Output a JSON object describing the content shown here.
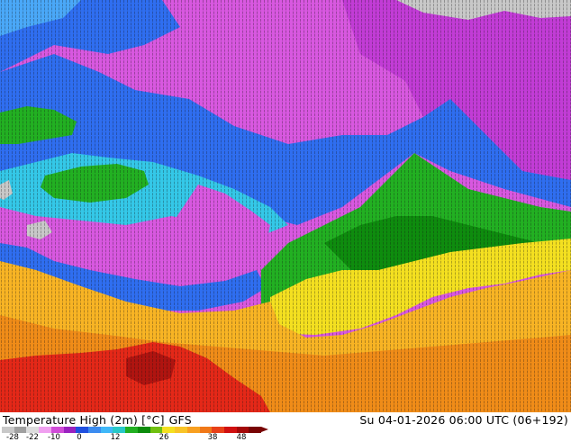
{
  "map": {
    "description_colors": {
      "deep_purple": "#7a1fa8",
      "purple": "#b428d8",
      "magenta": "#e060e8",
      "blue": "#2f6ef0",
      "light_blue": "#4aa8f8",
      "cyan": "#34c8e8",
      "green": "#22b022",
      "dark_green": "#0e8c0e",
      "yellow": "#f4e020",
      "orange": "#f8b424",
      "dark_orange": "#f08c18",
      "red": "#e42818",
      "gray": "#c8c8c8",
      "contour_black": "#101010"
    }
  },
  "footer": {
    "title_parts": [
      "Temperature High (2m) [°C]",
      "GFS"
    ],
    "valid_time": "Su 04-01-2026 06:00 UTC (06+192)"
  },
  "legend": {
    "ticks": [
      "-28",
      "-22",
      "-10",
      "0",
      "12",
      "26",
      "38",
      "48"
    ],
    "colors": [
      "#c8c8c8",
      "#a0a0a0",
      "#dcdcdc",
      "#f0a0f0",
      "#d04cd8",
      "#9a22c0",
      "#2050e0",
      "#3c8cf0",
      "#40b8f8",
      "#28c8c8",
      "#22b022",
      "#0c8c0c",
      "#70c010",
      "#f4e020",
      "#f8c428",
      "#f8a020",
      "#f07818",
      "#e84018",
      "#d01010",
      "#a40808",
      "#780404"
    ]
  }
}
